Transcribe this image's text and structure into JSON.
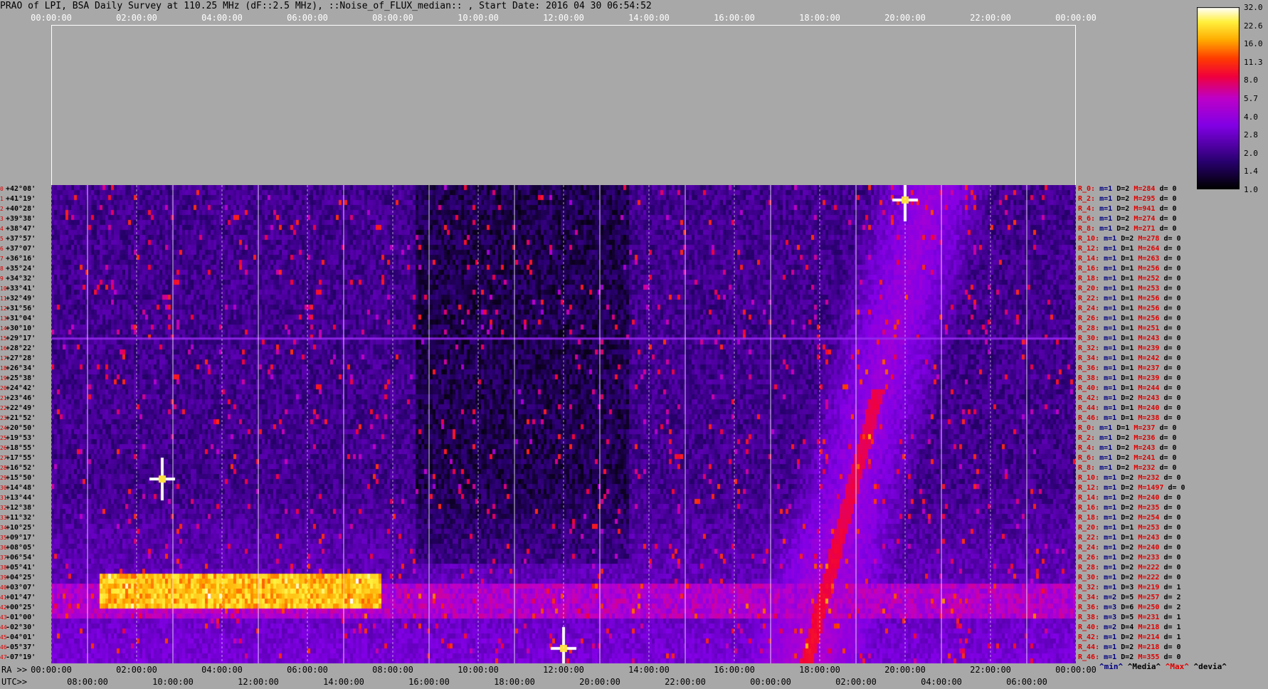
{
  "title": "PRAO of LPI, BSA Daily Survey at 110.25 MHz (dF::2.5 MHz), ::Noise_of_FLUX_median:: , Start Date: 2016 04 30 06:54:52",
  "colors": {
    "background": "#a8a8a8",
    "stat_red": "#e00000",
    "stat_blue": "#000080"
  },
  "chart_data": {
    "type": "heatmap",
    "title": "PRAO of LPI, BSA Daily Survey at 110.25 MHz (dF::2.5 MHz), ::Noise_of_FLUX_median:: , Start Date: 2016 04 30 06:54:52",
    "x_top_ticks": [
      "00:00:00",
      "02:00:00",
      "04:00:00",
      "06:00:00",
      "08:00:00",
      "10:00:00",
      "12:00:00",
      "14:00:00",
      "16:00:00",
      "18:00:00",
      "20:00:00",
      "22:00:00",
      "00:00:00"
    ],
    "x_ra_prefix": "RA >>",
    "x_ra_ticks": [
      "00:00:00",
      "02:00:00",
      "04:00:00",
      "06:00:00",
      "08:00:00",
      "10:00:00",
      "12:00:00",
      "14:00:00",
      "16:00:00",
      "18:00:00",
      "20:00:00",
      "22:00:00",
      "00:00:00"
    ],
    "x_utc_prefix": "UTC>>",
    "x_utc_ticks": [
      "08:00:00",
      "10:00:00",
      "12:00:00",
      "14:00:00",
      "16:00:00",
      "18:00:00",
      "20:00:00",
      "22:00:00",
      "00:00:00",
      "02:00:00",
      "04:00:00",
      "06:00:00"
    ],
    "colorbar": {
      "ticks": [
        "32.0",
        "22.6",
        "16.0",
        "11.3",
        "8.0",
        "5.7",
        "4.0",
        "2.8",
        "2.0",
        "1.4",
        "1.0"
      ],
      "min": 1.0,
      "max": 32.0,
      "scale": "log"
    },
    "features": [
      {
        "label": "bright horizontal band",
        "dec_rows": [
          39,
          42
        ],
        "ra_hours": [
          1.1,
          7.7
        ],
        "value": 22.6
      },
      {
        "label": "red horizontal band",
        "dec_rows": [
          40,
          43
        ],
        "ra_hours": [
          0,
          24
        ],
        "value": 6.0
      },
      {
        "label": "diagonal bright track",
        "ra_hours": [
          18.0,
          21.0
        ],
        "value": 8.0
      },
      {
        "label": "bright source",
        "ra_hours": 20.0,
        "dec_row": 1,
        "value": 32.0
      },
      {
        "label": "bright source",
        "ra_hours": 2.6,
        "dec_row": 29,
        "value": 32.0
      },
      {
        "label": "bright source",
        "ra_hours": 12.0,
        "dec_row": 46,
        "value": 32.0
      }
    ],
    "dec_labels": [
      "+42°08'",
      "+41°19'",
      "+40°28'",
      "+39°38'",
      "+38°47'",
      "+37°57'",
      "+37°07'",
      "+36°16'",
      "+35°24'",
      "+34°32'",
      "+33°41'",
      "+32°49'",
      "+31°56'",
      "+31°04'",
      "+30°10'",
      "+29°17'",
      "+28°22'",
      "+27°28'",
      "+26°34'",
      "+25°38'",
      "+24°42'",
      "+23°46'",
      "+22°49'",
      "+21°52'",
      "+20°50'",
      "+19°53'",
      "+18°55'",
      "+17°55'",
      "+16°52'",
      "+15°50'",
      "+14°48'",
      "+13°44'",
      "+12°38'",
      "+11°32'",
      "+10°25'",
      "+09°17'",
      "+08°05'",
      "+06°54'",
      "+05°41'",
      "+04°25'",
      "+03°07'",
      "+01°47'",
      "+00°25'",
      "-01°00'",
      "-02°30'",
      "-04°01'",
      "-05°37'",
      "-07°19'"
    ],
    "dec_index": [
      "0",
      "1",
      "2",
      "3",
      "4",
      "5",
      "6",
      "7",
      "8",
      "9",
      "10",
      "11",
      "12",
      "13",
      "14",
      "15",
      "16",
      "17",
      "18",
      "19",
      "20",
      "21",
      "22",
      "23",
      "24",
      "25",
      "26",
      "27",
      "28",
      "29",
      "30",
      "31",
      "32",
      "33",
      "34",
      "35",
      "36",
      "37",
      "38",
      "39",
      "40",
      "41",
      "42",
      "43",
      "44",
      "45",
      "46",
      "47"
    ],
    "row_stats": [
      {
        "r": "R_0:",
        "m": "m=1",
        "D": "D=2",
        "M": "M=284",
        "d": "d= 0"
      },
      {
        "r": "R_2:",
        "m": "m=1",
        "D": "D=2",
        "M": "M=295",
        "d": "d= 0"
      },
      {
        "r": "R_4:",
        "m": "m=1",
        "D": "D=2",
        "M": "M=941",
        "d": "d= 0"
      },
      {
        "r": "R_6:",
        "m": "m=1",
        "D": "D=2",
        "M": "M=274",
        "d": "d= 0"
      },
      {
        "r": "R_8:",
        "m": "m=1",
        "D": "D=2",
        "M": "M=271",
        "d": "d= 0"
      },
      {
        "r": "R_10:",
        "m": "m=1",
        "D": "D=2",
        "M": "M=278",
        "d": "d= 0"
      },
      {
        "r": "R_12:",
        "m": "m=1",
        "D": "D=1",
        "M": "M=264",
        "d": "d= 0"
      },
      {
        "r": "R_14:",
        "m": "m=1",
        "D": "D=1",
        "M": "M=263",
        "d": "d= 0"
      },
      {
        "r": "R_16:",
        "m": "m=1",
        "D": "D=1",
        "M": "M=256",
        "d": "d= 0"
      },
      {
        "r": "R_18:",
        "m": "m=1",
        "D": "D=1",
        "M": "M=252",
        "d": "d= 0"
      },
      {
        "r": "R_20:",
        "m": "m=1",
        "D": "D=1",
        "M": "M=253",
        "d": "d= 0"
      },
      {
        "r": "R_22:",
        "m": "m=1",
        "D": "D=1",
        "M": "M=256",
        "d": "d= 0"
      },
      {
        "r": "R_24:",
        "m": "m=1",
        "D": "D=1",
        "M": "M=256",
        "d": "d= 0"
      },
      {
        "r": "R_26:",
        "m": "m=1",
        "D": "D=1",
        "M": "M=256",
        "d": "d= 0"
      },
      {
        "r": "R_28:",
        "m": "m=1",
        "D": "D=1",
        "M": "M=251",
        "d": "d= 0"
      },
      {
        "r": "R_30:",
        "m": "m=1",
        "D": "D=1",
        "M": "M=243",
        "d": "d= 0"
      },
      {
        "r": "R_32:",
        "m": "m=1",
        "D": "D=1",
        "M": "M=239",
        "d": "d= 0"
      },
      {
        "r": "R_34:",
        "m": "m=1",
        "D": "D=1",
        "M": "M=242",
        "d": "d= 0"
      },
      {
        "r": "R_36:",
        "m": "m=1",
        "D": "D=1",
        "M": "M=237",
        "d": "d= 0"
      },
      {
        "r": "R_38:",
        "m": "m=1",
        "D": "D=1",
        "M": "M=239",
        "d": "d= 0"
      },
      {
        "r": "R_40:",
        "m": "m=1",
        "D": "D=1",
        "M": "M=244",
        "d": "d= 0"
      },
      {
        "r": "R_42:",
        "m": "m=1",
        "D": "D=2",
        "M": "M=243",
        "d": "d= 0"
      },
      {
        "r": "R_44:",
        "m": "m=1",
        "D": "D=1",
        "M": "M=240",
        "d": "d= 0"
      },
      {
        "r": "R_46:",
        "m": "m=1",
        "D": "D=1",
        "M": "M=238",
        "d": "d= 0"
      },
      {
        "r": "R_0:",
        "m": "m=1",
        "D": "D=1",
        "M": "M=237",
        "d": "d= 0"
      },
      {
        "r": "R_2:",
        "m": "m=1",
        "D": "D=2",
        "M": "M=236",
        "d": "d= 0"
      },
      {
        "r": "R_4:",
        "m": "m=1",
        "D": "D=2",
        "M": "M=243",
        "d": "d= 0"
      },
      {
        "r": "R_6:",
        "m": "m=1",
        "D": "D=2",
        "M": "M=241",
        "d": "d= 0"
      },
      {
        "r": "R_8:",
        "m": "m=1",
        "D": "D=2",
        "M": "M=232",
        "d": "d= 0"
      },
      {
        "r": "R_10:",
        "m": "m=1",
        "D": "D=2",
        "M": "M=232",
        "d": "d= 0"
      },
      {
        "r": "R_12:",
        "m": "m=1",
        "D": "D=2",
        "M": "M=1497",
        "d": "d= 0"
      },
      {
        "r": "R_14:",
        "m": "m=1",
        "D": "D=2",
        "M": "M=240",
        "d": "d= 0"
      },
      {
        "r": "R_16:",
        "m": "m=1",
        "D": "D=2",
        "M": "M=235",
        "d": "d= 0"
      },
      {
        "r": "R_18:",
        "m": "m=1",
        "D": "D=2",
        "M": "M=254",
        "d": "d= 0"
      },
      {
        "r": "R_20:",
        "m": "m=1",
        "D": "D=1",
        "M": "M=253",
        "d": "d= 0"
      },
      {
        "r": "R_22:",
        "m": "m=1",
        "D": "D=1",
        "M": "M=243",
        "d": "d= 0"
      },
      {
        "r": "R_24:",
        "m": "m=1",
        "D": "D=2",
        "M": "M=240",
        "d": "d= 0"
      },
      {
        "r": "R_26:",
        "m": "m=1",
        "D": "D=2",
        "M": "M=233",
        "d": "d= 0"
      },
      {
        "r": "R_28:",
        "m": "m=1",
        "D": "D=2",
        "M": "M=222",
        "d": "d= 0"
      },
      {
        "r": "R_30:",
        "m": "m=1",
        "D": "D=2",
        "M": "M=222",
        "d": "d= 0"
      },
      {
        "r": "R_32:",
        "m": "m=1",
        "D": "D=3",
        "M": "M=219",
        "d": "d= 1"
      },
      {
        "r": "R_34:",
        "m": "m=2",
        "D": "D=5",
        "M": "M=257",
        "d": "d= 2"
      },
      {
        "r": "R_36:",
        "m": "m=3",
        "D": "D=6",
        "M": "M=250",
        "d": "d= 2"
      },
      {
        "r": "R_38:",
        "m": "m=3",
        "D": "D=5",
        "M": "M=231",
        "d": "d= 1"
      },
      {
        "r": "R_40:",
        "m": "m=2",
        "D": "D=4",
        "M": "M=218",
        "d": "d= 1"
      },
      {
        "r": "R_42:",
        "m": "m=1",
        "D": "D=2",
        "M": "M=214",
        "d": "d= 1"
      },
      {
        "r": "R_44:",
        "m": "m=1",
        "D": "D=2",
        "M": "M=218",
        "d": "d= 0"
      },
      {
        "r": "R_46:",
        "m": "m=1",
        "D": "D=2",
        "M": "M=355",
        "d": "d= 0"
      }
    ],
    "legend_footer": {
      "min": "^min^",
      "median": "^Media^",
      "max": "^Max^",
      "dev": "^devia^"
    }
  }
}
